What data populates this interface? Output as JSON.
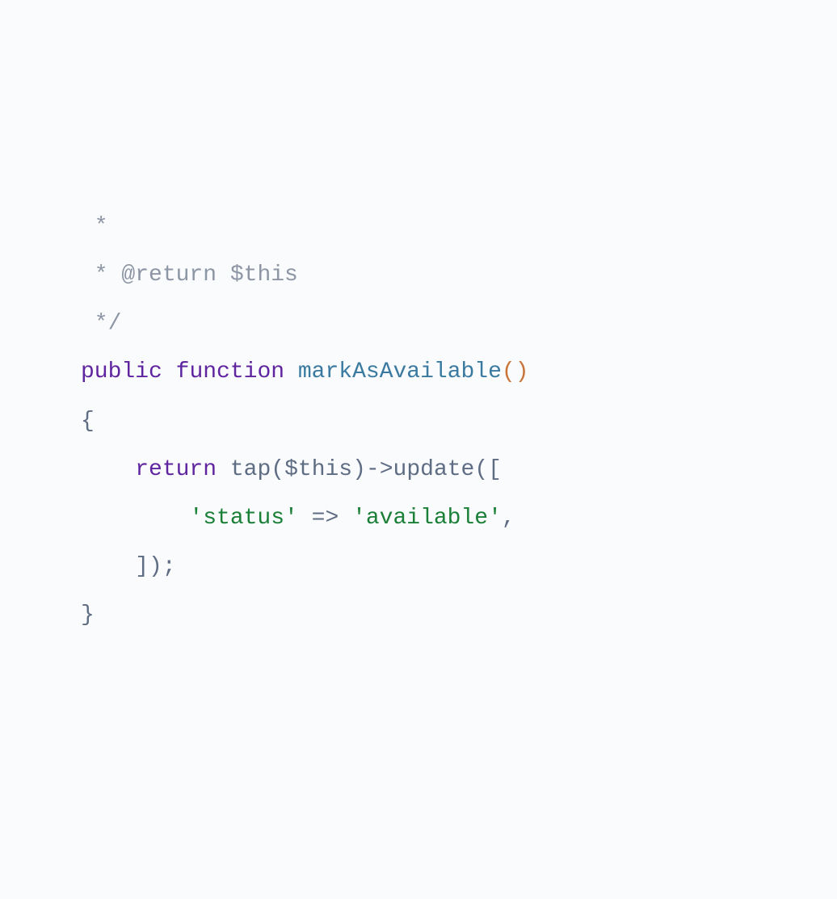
{
  "code": {
    "line1": " *",
    "line2_prefix": " * ",
    "line2_tag": "@return $this",
    "line3": " */",
    "kw_public": "public",
    "kw_function": "function",
    "fn_name": "markAsAvailable",
    "paren_open": "(",
    "paren_close": ")",
    "brace_open": "{",
    "kw_return": "return",
    "call_tap": "tap",
    "var_this": "$this",
    "arrow_op": "->",
    "call_update": "update",
    "bracket_open": "[",
    "str_key": "'status'",
    "fat_arrow": " => ",
    "str_val": "'available'",
    "comma": ",",
    "bracket_close": "]",
    "paren_close2": ")",
    "semicolon": ";",
    "brace_close": "}"
  }
}
